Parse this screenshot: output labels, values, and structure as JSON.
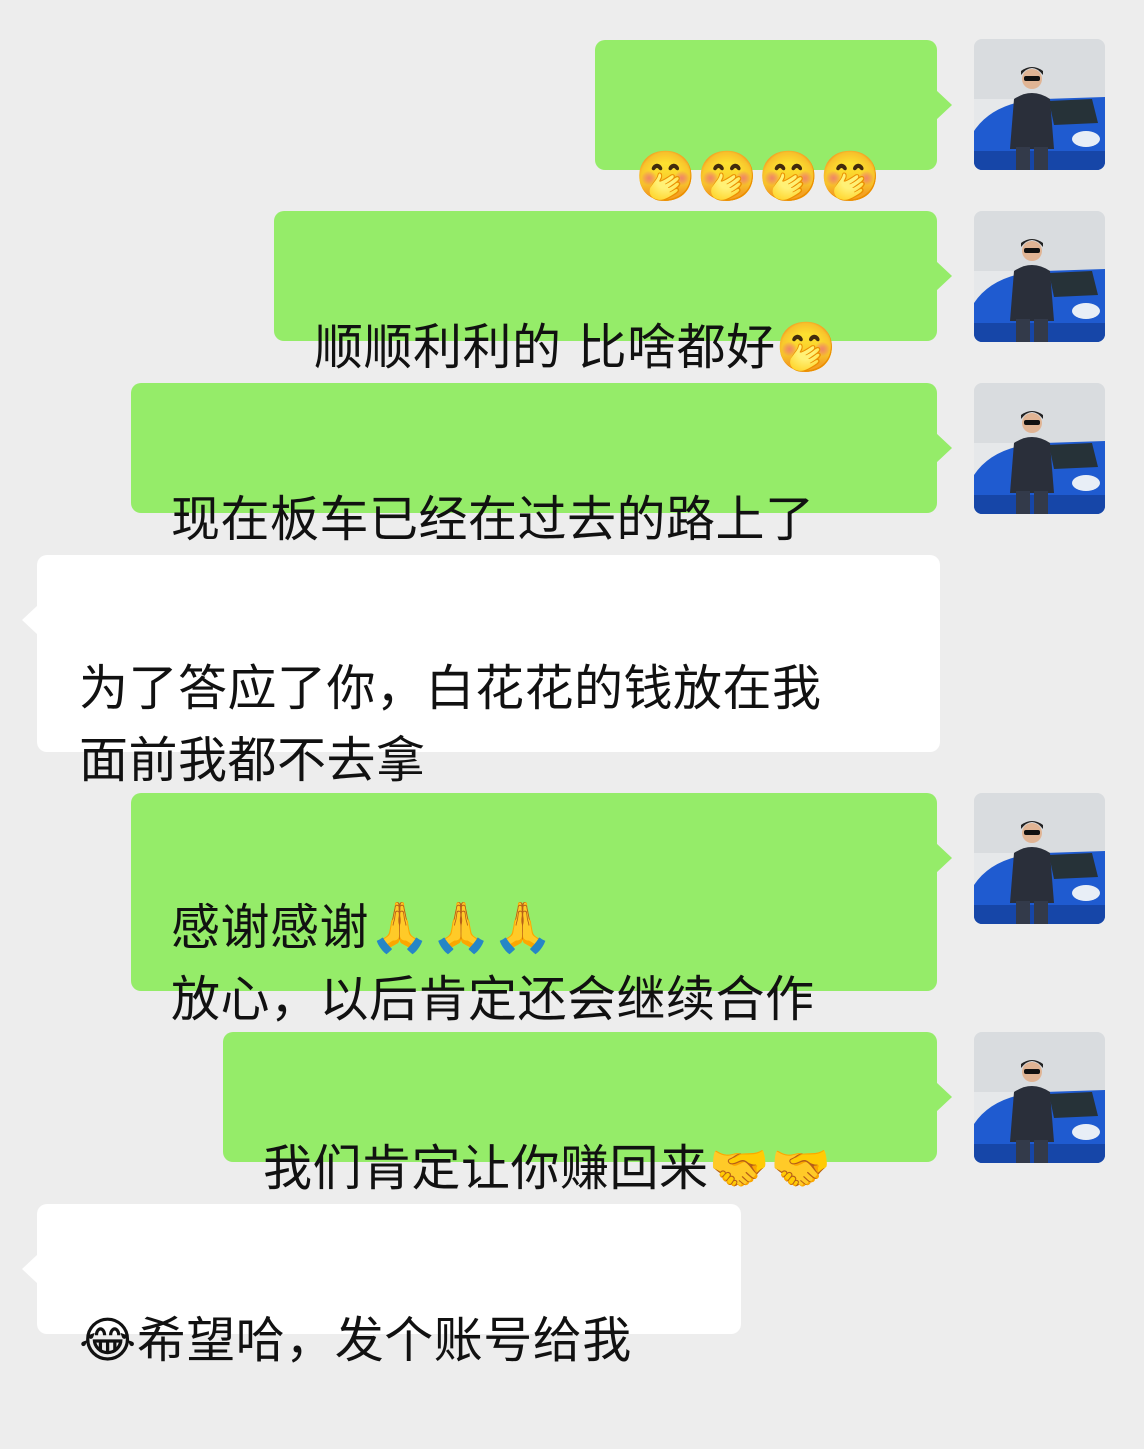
{
  "chat": {
    "messages": [
      {
        "side": "out",
        "text": "🤭🤭🤭🤭"
      },
      {
        "side": "out",
        "text": "顺顺利利的 比啥都好🤭"
      },
      {
        "side": "out",
        "text": "现在板车已经在过去的路上了"
      },
      {
        "side": "in",
        "text": "为了答应了你，白花花的钱放在我\n面前我都不去拿"
      },
      {
        "side": "out",
        "text": "感谢感谢🙏🙏🙏\n放心，以后肯定还会继续合作"
      },
      {
        "side": "out",
        "text": "我们肯定让你赚回来🤝🤝"
      },
      {
        "side": "in",
        "text": "😂希望哈，发个账号给我"
      }
    ]
  },
  "colors": {
    "background": "#ededed",
    "outgoing_bubble": "#95ec69",
    "incoming_bubble": "#ffffff",
    "text": "#111111"
  },
  "icons": {
    "avatar": "user-avatar-man-with-blue-car"
  }
}
